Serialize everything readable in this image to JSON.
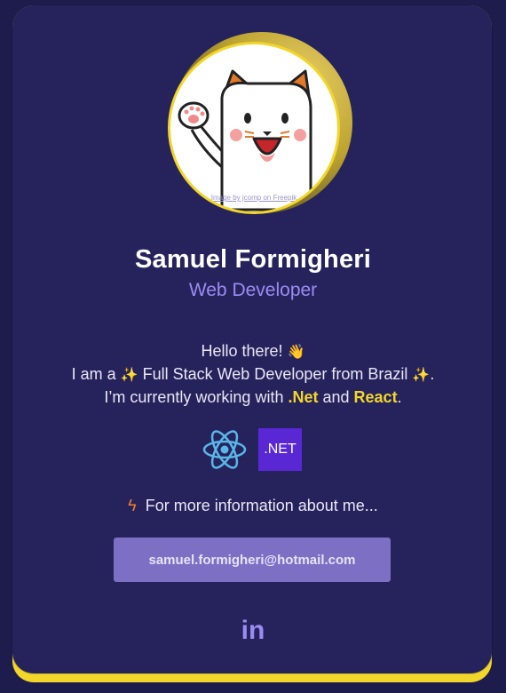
{
  "profile": {
    "avatar_credit": "Image by jcomp on Freepik",
    "name": "Samuel Formigheri",
    "role": "Web Developer"
  },
  "bio": {
    "line1_text": "Hello there! ",
    "line1_emoji": "👋",
    "line2_prefix": "I am a ",
    "line2_sparkle1": "✨",
    "line2_middle": " Full Stack Web Developer from Brazil ",
    "line2_sparkle2": "✨",
    "line2_suffix": ".",
    "line3_prefix": "I’m currently working with ",
    "line3_tech1": ".Net",
    "line3_and": " and ",
    "line3_tech2": "React",
    "line3_suffix": "."
  },
  "tech_icons": {
    "react_icon": "react-icon",
    "net_label": ".NET"
  },
  "more_info": {
    "icon": "lightning-icon",
    "label": "For more information about me..."
  },
  "contact": {
    "email": "samuel.formigheri@hotmail.com"
  },
  "social": {
    "linkedin_label": "in"
  },
  "colors": {
    "background": "#1e1c4d",
    "card": "#26235c",
    "accent_yellow": "#f2d62a",
    "accent_purple": "#9a8cf2",
    "button": "#7d6fc4"
  }
}
